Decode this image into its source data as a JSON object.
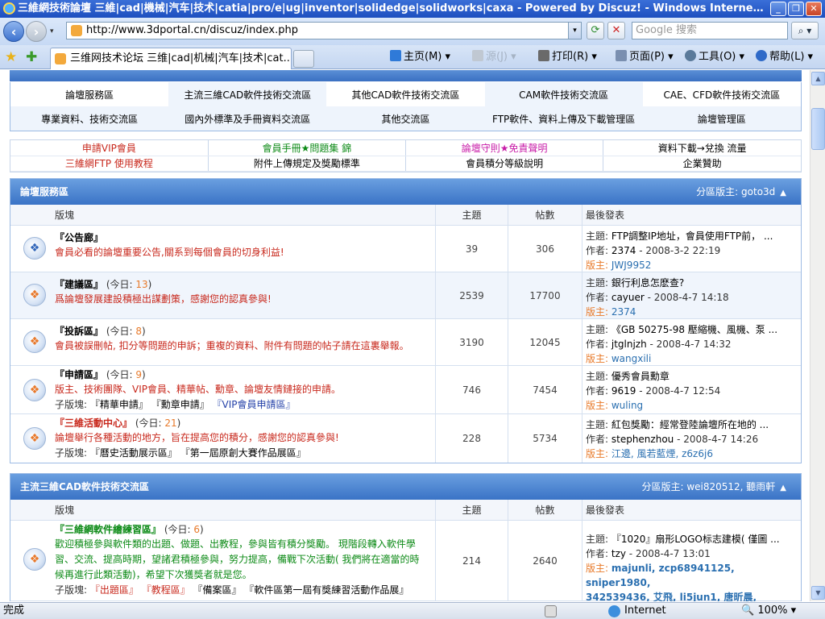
{
  "window": {
    "title": "三維網技術論壇 三維|cad|機械|汽车|技术|catia|pro/e|ug|inventor|solidedge|solidworks|caxa - Powered by Discuz! - Windows Internet Explorer",
    "min": "_",
    "max": "❐",
    "close": "✕"
  },
  "nav": {
    "back": "‹",
    "forward": "›",
    "drop": "▾",
    "url": "http://www.3dportal.cn/discuz/index.php",
    "url_drop": "▾",
    "refresh": "⟳",
    "stop": "✕",
    "search_placeholder": "Google 搜索",
    "search_btn": "⌕ ▾"
  },
  "tabs": {
    "fav_star": "★",
    "add_fav": "✚",
    "active_tab": "三维网技术论坛 三维|cad|机械|汽车|技术|cat...",
    "commands": [
      {
        "label": "主页(M)",
        "icon": "home-icon",
        "color": "#2f7ad8"
      },
      {
        "label": "源(J)",
        "icon": "feed-icon",
        "color": "#c0c8d2"
      },
      {
        "label": "打印(R)",
        "icon": "printer-icon",
        "color": "#6a6a6a"
      },
      {
        "label": "页面(P)",
        "icon": "page-icon",
        "color": "#7a8fb0"
      },
      {
        "label": "工具(O)",
        "icon": "gear-icon",
        "color": "#5a7a9a"
      },
      {
        "label": "帮助(L)",
        "icon": "help-icon",
        "color": "#2f6ac8"
      }
    ],
    "more": "»"
  },
  "catnav": {
    "row1": [
      "論壇服務區",
      "主流三維CAD軟件技術交流區",
      "其他CAD軟件技術交流區",
      "CAM軟件技術交流區",
      "CAE、CFD軟件技術交流區"
    ],
    "row2": [
      "專業資料、技術交流區",
      "國內外標準及手冊資料交流區",
      "其他交流區",
      "FTP軟件、資料上傳及下載管理區",
      "論壇管理區"
    ]
  },
  "links": {
    "row1": [
      {
        "label": "申請VIP會員",
        "color": "#c8281c"
      },
      {
        "label": "會員手冊★問題集 錦",
        "color": "#0c8a16"
      },
      {
        "label": "論壇守則★免責聲明",
        "color": "#c81ca8"
      },
      {
        "label": "資料下載→兌換 流量",
        "color": "#000000"
      }
    ],
    "row2": [
      {
        "label": "三維網FTP 使用教程",
        "color": "#c8281c"
      },
      {
        "label": "附件上傳規定及獎勵標準",
        "color": "#000000"
      },
      {
        "label": "會員積分等級說明",
        "color": "#000000"
      },
      {
        "label": "企業贊助",
        "color": "#000000"
      }
    ]
  },
  "cols": {
    "forum": "版塊",
    "topics": "主題",
    "posts": "帖數",
    "last": "最後發表"
  },
  "labels": {
    "topic": "主題: ",
    "author": "作者: ",
    "mod": "版主: ",
    "today_pre": " (今日: ",
    "today_post": ")",
    "sub": "子版塊: "
  },
  "sec1": {
    "title": "論壇服務區",
    "mods": "分區版主: goto3d",
    "caret": "▲",
    "rows": [
      {
        "name": "『公告廊』",
        "today": "",
        "desc": "會員必看的論壇重要公告,關系到每個會員的切身利益!",
        "subs": [],
        "topics": "39",
        "posts": "306",
        "last_title": "FTP調整IP地址，會員使用FTP前，  ...",
        "last_author": "2374",
        "last_time": " - 2008-3-2 22:19",
        "mod": "JWJ9952"
      },
      {
        "name": "『建議區』",
        "today": "13",
        "desc": "爲論壇發展建設積極出謀劃策，感謝您的認真參與!",
        "subs": [],
        "topics": "2539",
        "posts": "17700",
        "last_title": "銀行利息怎麽查?",
        "last_author": "cayuer",
        "last_time": " - 2008-4-7 14:18",
        "mod": "2374"
      },
      {
        "name": "『投訴區』",
        "today": "8",
        "desc": "會員被誤刪帖, 扣分等問題的申訴；重複的資料、附件有問題的帖子請在這裏舉報。",
        "subs": [],
        "topics": "3190",
        "posts": "12045",
        "last_title": "《GB 50275-98 壓縮機、風機、泵  ...",
        "last_author": "jtglnjzh",
        "last_time": " - 2008-4-7 14:32",
        "mod": "wangxili"
      },
      {
        "name": "『申請區』",
        "today": "9",
        "desc": "版主、技術團隊、VIP會員、精華帖、勳章、論壇友情鏈接的申請。",
        "subs": [
          "『精華申請』",
          "『勳章申請』",
          "『VIP會員申請區』"
        ],
        "topics": "746",
        "posts": "7454",
        "last_title": "優秀會員勳章",
        "last_author": "9619",
        "last_time": " - 2008-4-7 12:54",
        "mod": "wuling"
      },
      {
        "name": "『三維活動中心』",
        "today": "21",
        "desc": "論壇舉行各種活動的地方，旨在提高您的積分，感謝您的認真參與!",
        "subs": [
          "『曆史活動展示區』",
          "『第一屆原創大賽作品展區』"
        ],
        "topics": "228",
        "posts": "5734",
        "last_title": "紅包獎勵：經常登陸論壇所在地的  ...",
        "last_author": "stephenzhou",
        "last_time": " - 2008-4-7 14:26",
        "mod": "江邊, 風若藍煙, z6z6j6"
      }
    ]
  },
  "sec2": {
    "title": "主流三維CAD軟件技術交流區",
    "mods": "分區版主: wei820512, 聽雨軒",
    "caret": "▲",
    "row": {
      "name": "『三維網軟件繪練習區』",
      "today": "6",
      "desc": "歡迎積極參與軟件類的出題、做題、出教程，參與皆有積分獎勵。 現階段轉入軟件學習、交流、提高時期，望諸君積極參與，努力提高，備戰下次活動( 我們將在適當的時候再進行此類活動)，希望下次獲獎者就是您。",
      "subs": [
        "『出題區』",
        "『教程區』",
        "『備案區』",
        "『軟件區第一屆有獎練習活動作品展』"
      ],
      "topics": "214",
      "posts": "2640",
      "last_title": "『1020』扇形LOGO标志建模( 僅圖  ...",
      "last_author": "tzy",
      "last_time": " - 2008-4-7 13:01",
      "mod_line1": "majunli, zcp68941125, sniper1980,",
      "mod_line2": "342539436, 艾飛, li5jun1, 唐昕晨, design_er"
    }
  },
  "status": {
    "text": "完成",
    "zone": "Internet",
    "zoom": "🔍 100%  ▾"
  }
}
